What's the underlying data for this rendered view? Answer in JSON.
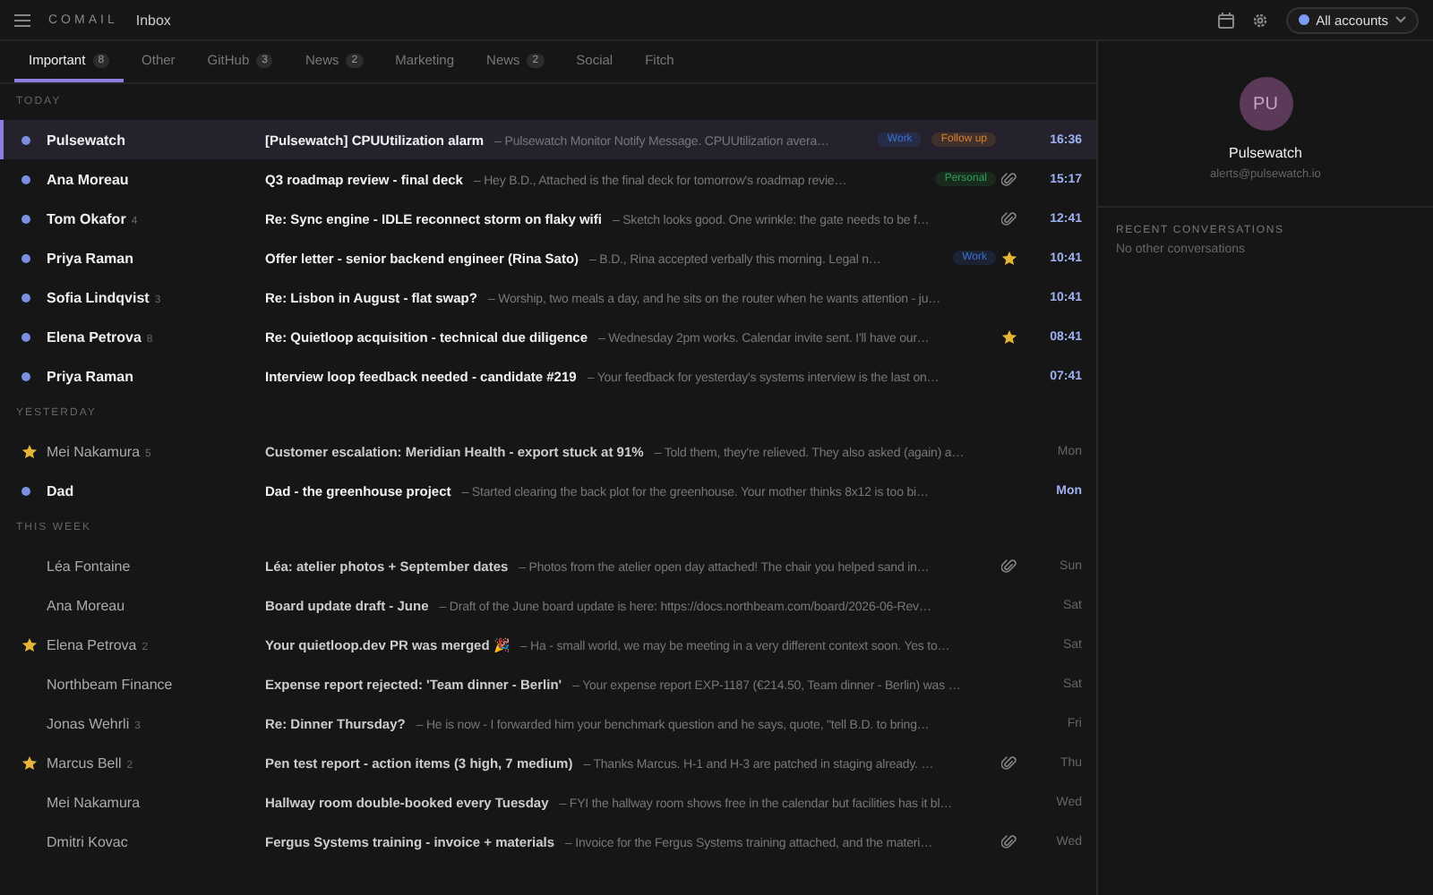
{
  "app": {
    "logo": "COMAIL",
    "folder": "Inbox",
    "account": "All accounts"
  },
  "tabs": [
    {
      "label": "Important",
      "count": "8",
      "selected": true
    },
    {
      "label": "Other",
      "selected": false
    },
    {
      "label": "GitHub",
      "count": "3",
      "selected": false
    },
    {
      "label": "News",
      "count": "2",
      "selected": false
    },
    {
      "label": "Marketing",
      "selected": false
    },
    {
      "label": "News",
      "count": "2",
      "selected": false
    },
    {
      "label": "Social",
      "selected": false
    },
    {
      "label": "Fitch",
      "selected": false
    }
  ],
  "groups": [
    {
      "title": "TODAY",
      "rows": [
        {
          "sender": "Pulsewatch",
          "subject": "[Pulsewatch] CPUUtilization alarm",
          "preview": "– Pulsewatch Monitor Notify Message. CPUUtilization avera…",
          "labels": [
            {
              "text": "Work",
              "color": "#3b6fd8"
            },
            {
              "text": "Follow up",
              "color": "#d9822b"
            }
          ],
          "time": "16:36",
          "unread": true,
          "starred": false,
          "attachment": false,
          "selected": true
        },
        {
          "sender": "Ana Moreau",
          "subject": "Q3 roadmap review - final deck",
          "preview": "– Hey B.D., Attached is the final deck for tomorrow's roadmap revie…",
          "labels": [
            {
              "text": "Personal",
              "color": "#2f9e55"
            }
          ],
          "time": "15:17",
          "unread": true,
          "starred": false,
          "attachment": true,
          "selected": false
        },
        {
          "sender": "Tom Okafor",
          "count": "4",
          "subject": "Re: Sync engine - IDLE reconnect storm on flaky wifi",
          "preview": "– Sketch looks good. One wrinkle: the gate needs to be f…",
          "time": "12:41",
          "unread": true,
          "starred": false,
          "attachment": true,
          "selected": false
        },
        {
          "sender": "Priya Raman",
          "subject": "Offer letter - senior backend engineer (Rina Sato)",
          "preview": "– B.D., Rina accepted verbally this morning. Legal n…",
          "labels": [
            {
              "text": "Work",
              "color": "#3b6fd8"
            }
          ],
          "time": "10:41",
          "unread": true,
          "starred": true,
          "attachment": false,
          "selected": false
        },
        {
          "sender": "Sofia Lindqvist",
          "count": "3",
          "subject": "Re: Lisbon in August - flat swap?",
          "preview": "– Worship, two meals a day, and he sits on the router when he wants attention - ju…",
          "time": "10:41",
          "unread": true,
          "starred": false,
          "attachment": false,
          "selected": false
        },
        {
          "sender": "Elena Petrova",
          "count": "8",
          "subject": "Re: Quietloop acquisition - technical due diligence",
          "preview": "– Wednesday 2pm works. Calendar invite sent. I'll have our…",
          "time": "08:41",
          "unread": true,
          "starred": true,
          "attachment": false,
          "selected": false
        },
        {
          "sender": "Priya Raman",
          "subject": "Interview loop feedback needed - candidate #219",
          "preview": "– Your feedback for yesterday's systems interview is the last on…",
          "time": "07:41",
          "unread": true,
          "starred": false,
          "attachment": false,
          "selected": false
        }
      ]
    },
    {
      "title": "YESTERDAY",
      "rows": [
        {
          "sender": "Mei Nakamura",
          "count": "5",
          "subject": "Customer escalation: Meridian Health - export stuck at 91%",
          "preview": "– Told them, they're relieved. They also asked (again) a…",
          "time": "Mon",
          "unread": false,
          "starred": true,
          "attachment": false,
          "selected": false
        },
        {
          "sender": "Dad",
          "subject": "Dad - the greenhouse project",
          "preview": "– Started clearing the back plot for the greenhouse. Your mother thinks 8x12 is too bi…",
          "time": "Mon",
          "unread": true,
          "starred": false,
          "attachment": false,
          "selected": false
        }
      ]
    },
    {
      "title": "THIS WEEK",
      "rows": [
        {
          "sender": "Léa Fontaine",
          "subject": "Léa: atelier photos + September dates",
          "preview": "– Photos from the atelier open day attached! The chair you helped sand in…",
          "time": "Sun",
          "unread": false,
          "starred": false,
          "attachment": true,
          "selected": false
        },
        {
          "sender": "Ana Moreau",
          "subject": "Board update draft - June",
          "preview": "– Draft of the June board update is here: https://docs.northbeam.com/board/2026-06-Rev…",
          "time": "Sat",
          "unread": false,
          "starred": false,
          "attachment": false,
          "selected": false
        },
        {
          "sender": "Elena Petrova",
          "count": "2",
          "subject": "Your quietloop.dev PR was merged 🎉",
          "preview": "– Ha - small world, we may be meeting in a very different context soon. Yes to…",
          "time": "Sat",
          "unread": false,
          "starred": true,
          "attachment": false,
          "selected": false
        },
        {
          "sender": "Northbeam Finance",
          "subject": "Expense report rejected: 'Team dinner - Berlin'",
          "preview": "– Your expense report EXP-1187 (€214.50, Team dinner - Berlin) was …",
          "time": "Sat",
          "unread": false,
          "starred": false,
          "attachment": false,
          "selected": false
        },
        {
          "sender": "Jonas Wehrli",
          "count": "3",
          "subject": "Re: Dinner Thursday?",
          "preview": "– He is now - I forwarded him your benchmark question and he says, quote, \"tell B.D. to bring…",
          "time": "Fri",
          "unread": false,
          "starred": false,
          "attachment": false,
          "selected": false
        },
        {
          "sender": "Marcus Bell",
          "count": "2",
          "subject": "Pen test report - action items (3 high, 7 medium)",
          "preview": "– Thanks Marcus. H-1 and H-3 are patched in staging already. …",
          "time": "Thu",
          "unread": false,
          "starred": true,
          "attachment": true,
          "selected": false
        },
        {
          "sender": "Mei Nakamura",
          "subject": "Hallway room double-booked every Tuesday",
          "preview": "– FYI the hallway room shows free in the calendar but facilities has it bl…",
          "time": "Wed",
          "unread": false,
          "starred": false,
          "attachment": false,
          "selected": false
        },
        {
          "sender": "Dmitri Kovac",
          "subject": "Fergus Systems training - invoice + materials",
          "preview": "– Invoice for the Fergus Systems training attached, and the materi…",
          "time": "Wed",
          "unread": false,
          "starred": false,
          "attachment": true,
          "selected": false
        }
      ]
    }
  ],
  "contact": {
    "initials": "PU",
    "name": "Pulsewatch",
    "email": "alerts@pulsewatch.io",
    "section_title": "RECENT CONVERSATIONS",
    "empty_text": "No other conversations"
  }
}
